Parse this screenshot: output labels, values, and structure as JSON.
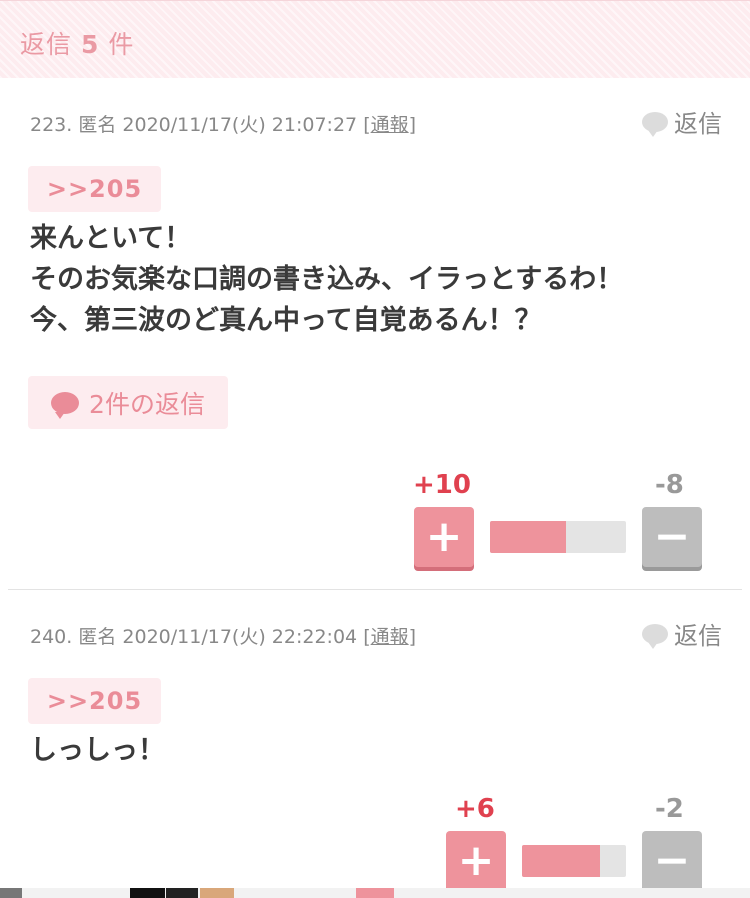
{
  "header": {
    "prefix": "返信",
    "count": "5",
    "suffix": "件"
  },
  "comments": [
    {
      "number": "223.",
      "author": "匿名",
      "datetime": "2020/11/17(火) 21:07:27",
      "report_open": "[",
      "report_label": "通報",
      "report_close": "]",
      "reply_label": "返信",
      "anchor": ">>205",
      "lines": [
        "来んといて！",
        "そのお気楽な口調の書き込み、イラっとするわ！",
        "今、第三波のど真ん中って自覚あるん！？"
      ],
      "replies_button": "2件の返信",
      "plus_count": "+10",
      "minus_count": "-8",
      "plus_ratio": 0.56
    },
    {
      "number": "240.",
      "author": "匿名",
      "datetime": "2020/11/17(火) 22:22:04",
      "report_open": "[",
      "report_label": "通報",
      "report_close": "]",
      "reply_label": "返信",
      "anchor": ">>205",
      "lines": [
        "しっしっ！"
      ],
      "plus_count": "+6",
      "minus_count": "-2",
      "plus_ratio": 0.75
    }
  ],
  "vote_symbols": {
    "plus": "+",
    "minus": "−"
  },
  "colors": {
    "accent_pink": "#ea8c98",
    "vote_plus": "#e0414f",
    "vote_minus": "#999999",
    "header_bg": "#fdecef"
  }
}
